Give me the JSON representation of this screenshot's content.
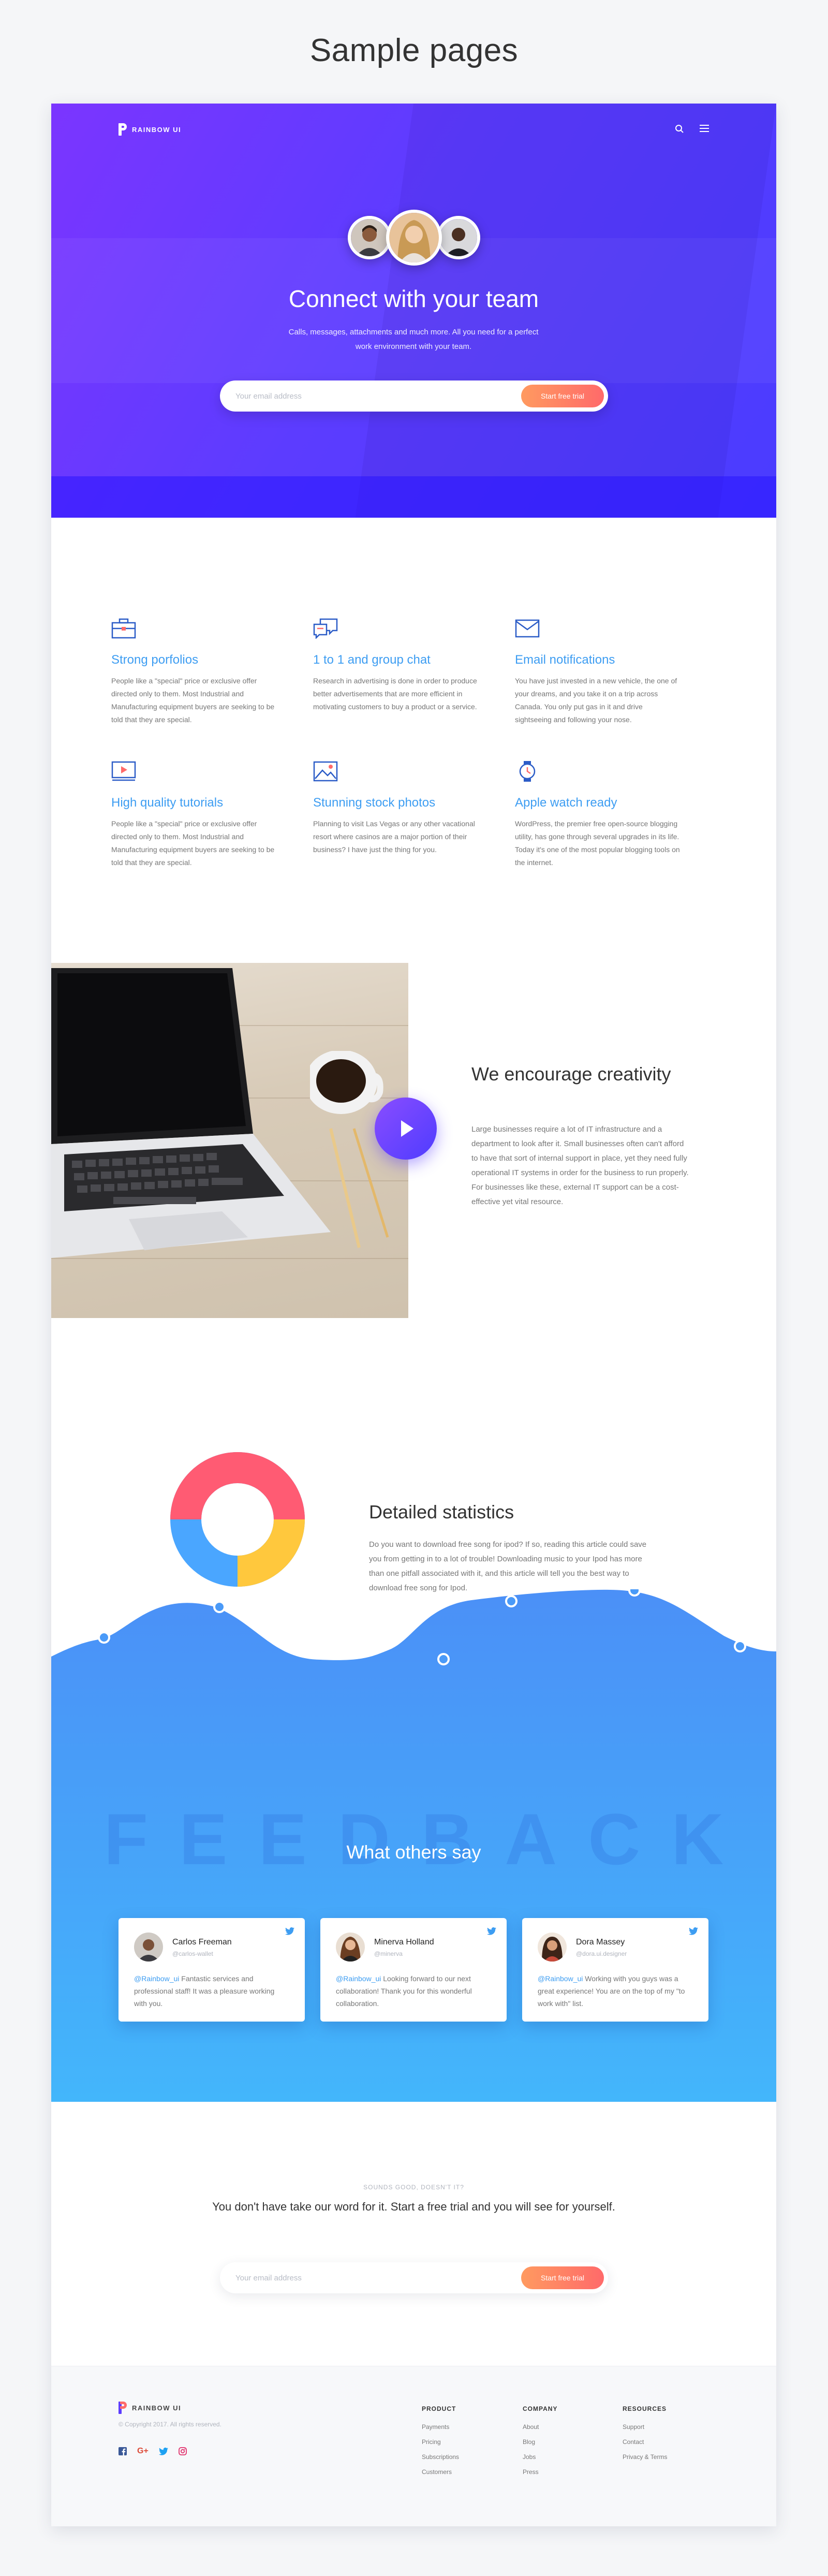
{
  "page": {
    "heading": "Sample pages"
  },
  "nav": {
    "brand": "RAINBOW UI"
  },
  "hero": {
    "title": "Connect with your team",
    "subtitle": "Calls, messages, attachments and much more. All you need for a perfect work environment with your team.",
    "email_placeholder": "Your email address",
    "cta": "Start free trial"
  },
  "features": [
    {
      "icon": "briefcase-icon",
      "title": "Strong porfolios",
      "text": "People like a \"special\" price or exclusive offer directed only to them. Most Industrial and Manufacturing equipment buyers are seeking to be told that they are special."
    },
    {
      "icon": "chat-icon",
      "title": "1 to 1 and group chat",
      "text": "Research in advertising is done in order to produce better advertisements that are more efficient in motivating customers to buy a product or a service."
    },
    {
      "icon": "mail-icon",
      "title": "Email notifications",
      "text": "You have just invested in a new vehicle, the one of your dreams, and you take it on a trip across Canada. You only put gas in it and drive sightseeing and following your nose."
    },
    {
      "icon": "video-icon",
      "title": "High quality tutorials",
      "text": "People like a \"special\" price or exclusive offer directed only to them. Most Industrial and Manufacturing equipment buyers are seeking to be told that they are special."
    },
    {
      "icon": "image-icon",
      "title": "Stunning stock photos",
      "text": "Planning to visit Las Vegas or any other vacational resort where casinos are a major portion of their business? I have just the thing for you."
    },
    {
      "icon": "watch-icon",
      "title": "Apple watch ready",
      "text": "WordPress, the premier free open-source blogging utility, has gone through several upgrades in its life. Today it's one of the most popular blogging tools on the internet."
    }
  ],
  "creativity": {
    "title": "We encourage creativity",
    "text": "Large businesses require a lot of IT infrastructure and a department to look after it. Small businesses often can't afford to have that sort of internal support in place, yet they need fully operational IT systems in order for the business to run properly. For businesses like these, external IT support can be a cost-effective yet vital resource."
  },
  "stats": {
    "title": "Detailed statistics",
    "text": "Do you want to download free song for ipod? If so, reading this article could save you from getting in to a lot of trouble! Downloading music to your Ipod has more than one pitfall associated with it, and this article will tell you the best way to download free song for Ipod.",
    "colors": {
      "red": "#ff5b73",
      "yellow": "#ffc83d",
      "blue": "#4aa6ff"
    }
  },
  "feedback": {
    "watermark": "FEEDBACK",
    "title": "What others say",
    "cards": [
      {
        "name": "Carlos Freeman",
        "role": "@carlos-wallet",
        "handle": "@Rainbow_ui",
        "text": " Fantastic services and professional staff! It was a pleasure working with you."
      },
      {
        "name": "Minerva Holland",
        "role": "@minerva",
        "handle": "@Rainbow_ui",
        "text": " Looking forward to our next collaboration! Thank you for this wonderful collaboration."
      },
      {
        "name": "Dora Massey",
        "role": "@dora.ui.designer",
        "handle": "@Rainbow_ui",
        "text": " Working with you guys was a great experience! You are on the top of my \"to work with\" list."
      }
    ]
  },
  "trial": {
    "eyebrow": "SOUNDS GOOD, DOESN'T IT?",
    "title": "You don't have take our word for it. Start a free trial and you will see for yourself.",
    "email_placeholder": "Your email address",
    "cta": "Start free trial"
  },
  "footer": {
    "brand": "RAINBOW UI",
    "copyright": "© Copyright 2017. All rights reserved.",
    "socials": [
      "facebook-icon",
      "google-plus-icon",
      "twitter-icon",
      "instagram-icon"
    ],
    "columns": [
      {
        "title": "PRODUCT",
        "links": [
          "Payments",
          "Pricing",
          "Subscriptions",
          "Customers"
        ]
      },
      {
        "title": "COMPANY",
        "links": [
          "About",
          "Blog",
          "Jobs",
          "Press"
        ]
      },
      {
        "title": "RESOURCES",
        "links": [
          "Support",
          "Contact",
          "Privacy & Terms"
        ]
      }
    ]
  }
}
